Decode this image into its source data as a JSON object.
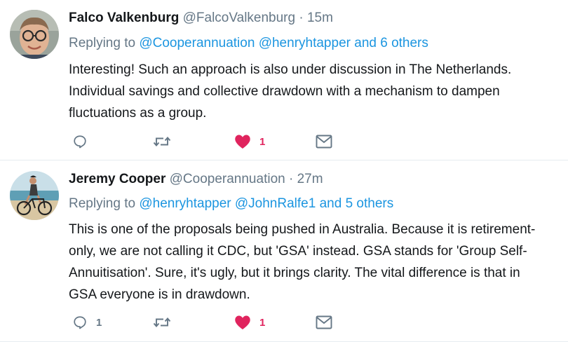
{
  "tweets": [
    {
      "name": "Falco Valkenburg",
      "handle": "@FalcoValkenburg",
      "separator": "·",
      "time": "15m",
      "replying_prefix": "Replying to",
      "mentions": [
        "@Cooperannuation",
        "@henryhtapper"
      ],
      "others": "and 6 others",
      "text_lines": [
        "Interesting! Such an approach is also under discussion in The Netherlands.",
        "Individual savings and collective drawdown with a mechanism to dampen",
        "fluctuations as a group."
      ],
      "reply_count": "",
      "retweet_count": "",
      "like_count": "1",
      "liked": true,
      "icons": [
        "reply-icon",
        "retweet-icon",
        "heart-icon",
        "envelope-icon"
      ]
    },
    {
      "name": "Jeremy Cooper",
      "handle": "@Cooperannuation",
      "separator": "·",
      "time": "27m",
      "replying_prefix": "Replying to",
      "mentions": [
        "@henryhtapper",
        "@JohnRalfe1"
      ],
      "others": "and 5 others",
      "text_lines": [
        "This is one of the proposals being pushed in Australia. Because it is retirement-",
        "only, we are not calling it CDC, but 'GSA' instead. GSA stands for 'Group Self-",
        "Annuitisation'. Sure, it's ugly, but it brings clarity. The vital difference is that in",
        "GSA everyone is in drawdown."
      ],
      "reply_count": "1",
      "retweet_count": "",
      "like_count": "1",
      "liked": true,
      "icons": [
        "reply-icon",
        "retweet-icon",
        "heart-icon",
        "envelope-icon"
      ]
    }
  ],
  "colors": {
    "link": "#1b95e0",
    "secondary_text": "#657786",
    "like": "#e0245e",
    "divider": "#e6ecf0"
  }
}
